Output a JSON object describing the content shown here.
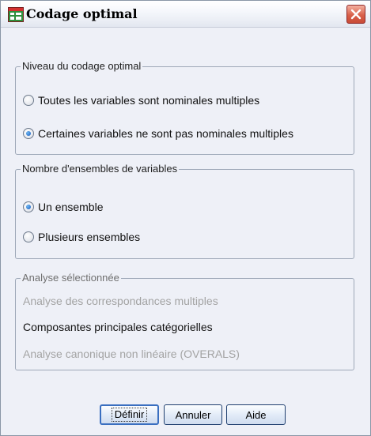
{
  "window": {
    "title": "Codage optimal",
    "icon": "spreadsheet-icon"
  },
  "groups": {
    "level": {
      "legend": "Niveau du codage optimal",
      "options": [
        {
          "label": "Toutes les variables sont nominales multiples",
          "checked": false
        },
        {
          "label": "Certaines variables ne sont pas nominales multiples",
          "checked": true
        }
      ]
    },
    "sets": {
      "legend": "Nombre d'ensembles de variables",
      "options": [
        {
          "label": "Un ensemble",
          "checked": true
        },
        {
          "label": "Plusieurs ensembles",
          "checked": false
        }
      ]
    },
    "analysis": {
      "legend": "Analyse sélectionnée",
      "items": [
        {
          "label": "Analyse des correspondances multiples",
          "active": false
        },
        {
          "label": "Composantes principales catégorielles",
          "active": true
        },
        {
          "label": "Analyse canonique non linéaire (OVERALS)",
          "active": false
        }
      ]
    }
  },
  "buttons": {
    "define": "Définir",
    "cancel": "Annuler",
    "help": "Aide"
  },
  "colors": {
    "accent": "#1558c0",
    "close": "#d9604a"
  }
}
